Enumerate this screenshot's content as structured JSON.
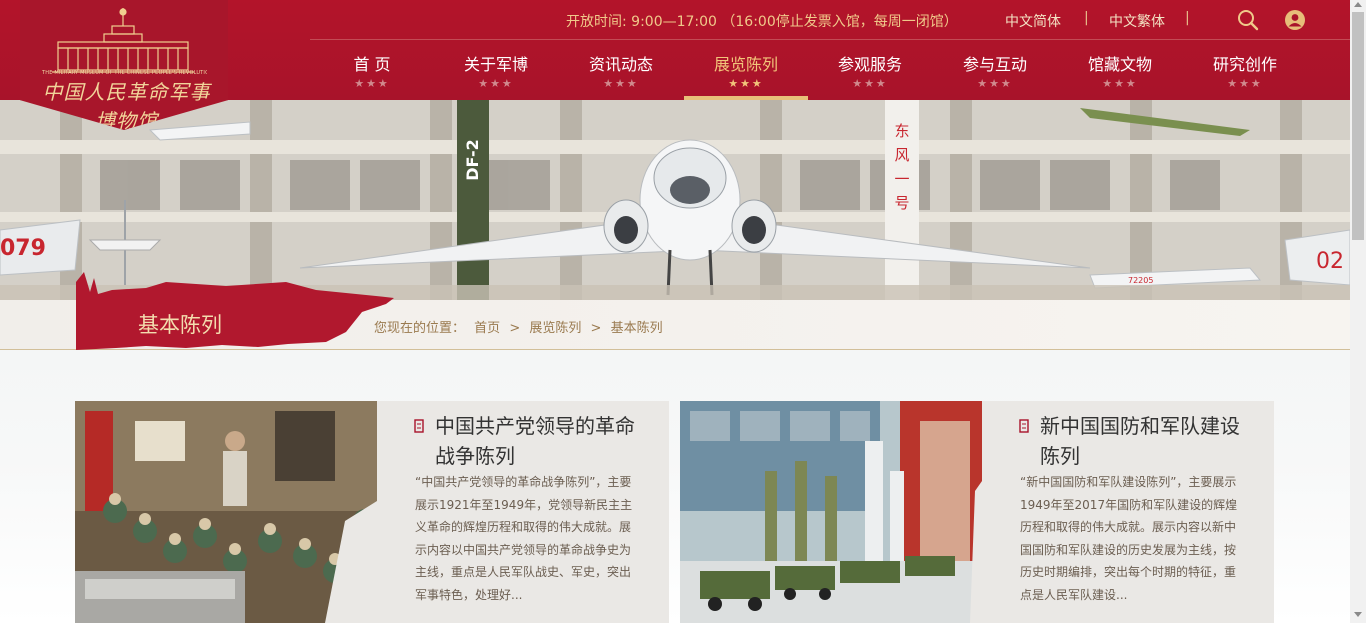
{
  "logo": {
    "subtitle": "THE MILITARY MUSEUM OF THE CHINESE PEOPLE'S REVOLUTION",
    "calligraphy": "中国人民革命军事博物馆",
    "icon": "museum-building-icon"
  },
  "topbar": {
    "hours": "开放时间: 9:00—17:00 （16:00停止发票入馆，每周一闭馆）",
    "lang_simplified": "中文简体",
    "lang_traditional": "中文繁体",
    "separator": "|",
    "search_icon": "search-icon",
    "user_icon": "user-icon"
  },
  "nav": [
    {
      "label": "首 页",
      "stars": "★★★"
    },
    {
      "label": "关于军博",
      "stars": "★★★"
    },
    {
      "label": "资讯动态",
      "stars": "★★★"
    },
    {
      "label": "展览陈列",
      "stars": "★★★",
      "active": true
    },
    {
      "label": "参观服务",
      "stars": "★★★"
    },
    {
      "label": "参与互动",
      "stars": "★★★"
    },
    {
      "label": "馆藏文物",
      "stars": "★★★"
    },
    {
      "label": "研究创作",
      "stars": "★★★"
    }
  ],
  "hero": {
    "markings": [
      "DF-2",
      "东风一号",
      "079",
      "72205",
      "02"
    ]
  },
  "section": {
    "title": "基本陈列"
  },
  "breadcrumb": {
    "prefix": "您现在的位置：",
    "items": [
      "首页",
      "展览陈列",
      "基本陈列"
    ],
    "separator": ">"
  },
  "cards": [
    {
      "title": "中国共产党领导的革命战争陈列",
      "description": "“中国共产党领导的革命战争陈列”，主要展示1921年至1949年，党领导新民主主义革命的辉煌历程和取得的伟大成就。展示内容以中国共产党领导的革命战争史为主线，重点是人民军队战史、军史，突出军事特色，处理好..."
    },
    {
      "title": "新中国国防和军队建设陈列",
      "description": "“新中国国防和军队建设陈列”，主要展示1949年至2017年国防和军队建设的辉煌历程和取得的伟大成就。展示内容以新中国国防和军队建设的历史发展为主线，按历史时期编排，突出每个时期的特征，重点是人民军队建设..."
    }
  ],
  "colors": {
    "brand_red": "#a8132a",
    "gold": "#f2c57a",
    "crumb": "#9a7a4f"
  }
}
